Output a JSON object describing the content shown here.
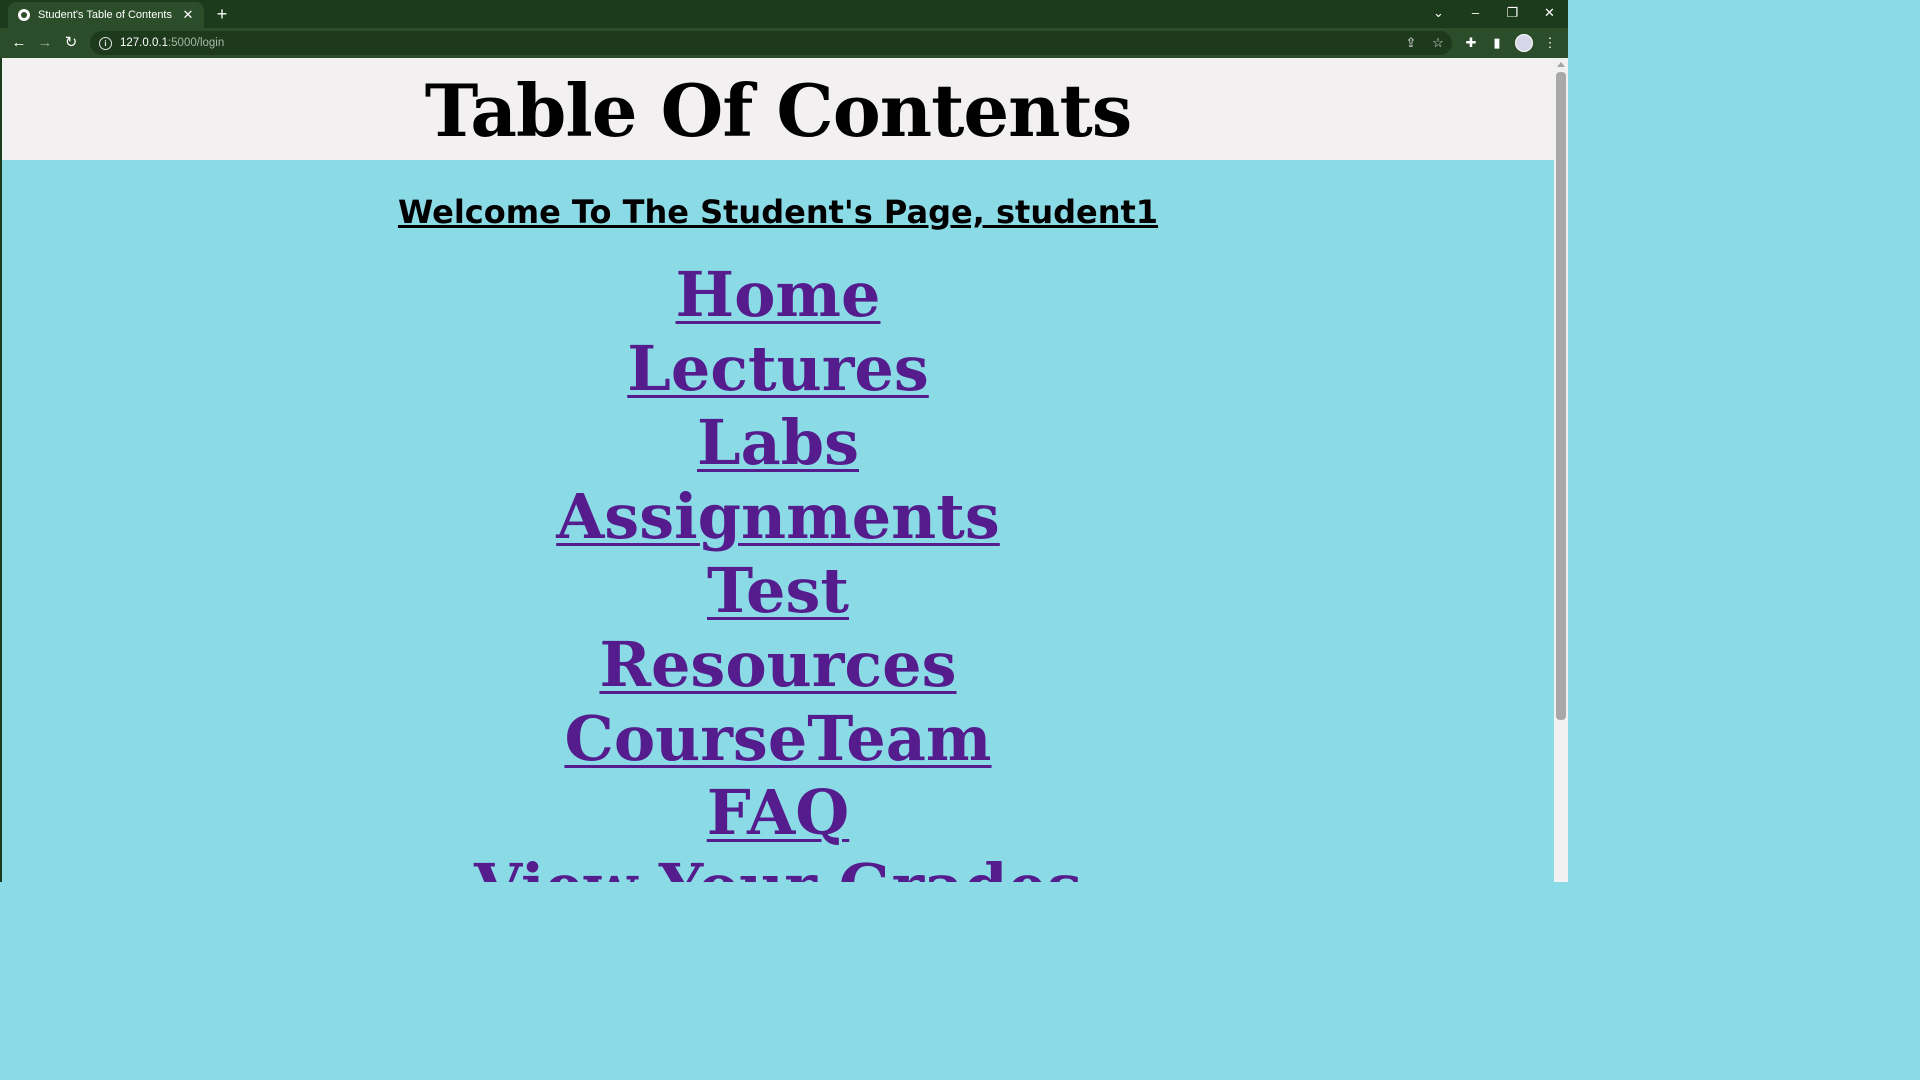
{
  "browser": {
    "tab_title": "Student's Table of Contents",
    "tab_close": "✕",
    "new_tab": "+",
    "url_host": "127.0.0.1",
    "url_rest": ":5000/login",
    "icons": {
      "back": "←",
      "forward": "→",
      "reload": "↻",
      "share": "⇪",
      "star": "☆",
      "extensions": "✚",
      "sidebar": "▮",
      "menu": "⋮",
      "tab_search": "⌄",
      "minimize": "–",
      "restore": "❐",
      "close": "✕"
    },
    "colors": {
      "tabbar": "#1c3a1c",
      "toolbar": "#2b4d2a"
    }
  },
  "page": {
    "title": "Table Of Contents",
    "welcome": "Welcome To The Student's Page, student1",
    "links": [
      "Home",
      "Lectures",
      "Labs",
      "Assignments",
      "Test",
      "Resources",
      "CourseTeam",
      "FAQ",
      "View Your Grades"
    ],
    "colors": {
      "header_bg": "#f2f0f0",
      "body_bg": "#8bdbe7",
      "link": "#541c8c"
    }
  }
}
